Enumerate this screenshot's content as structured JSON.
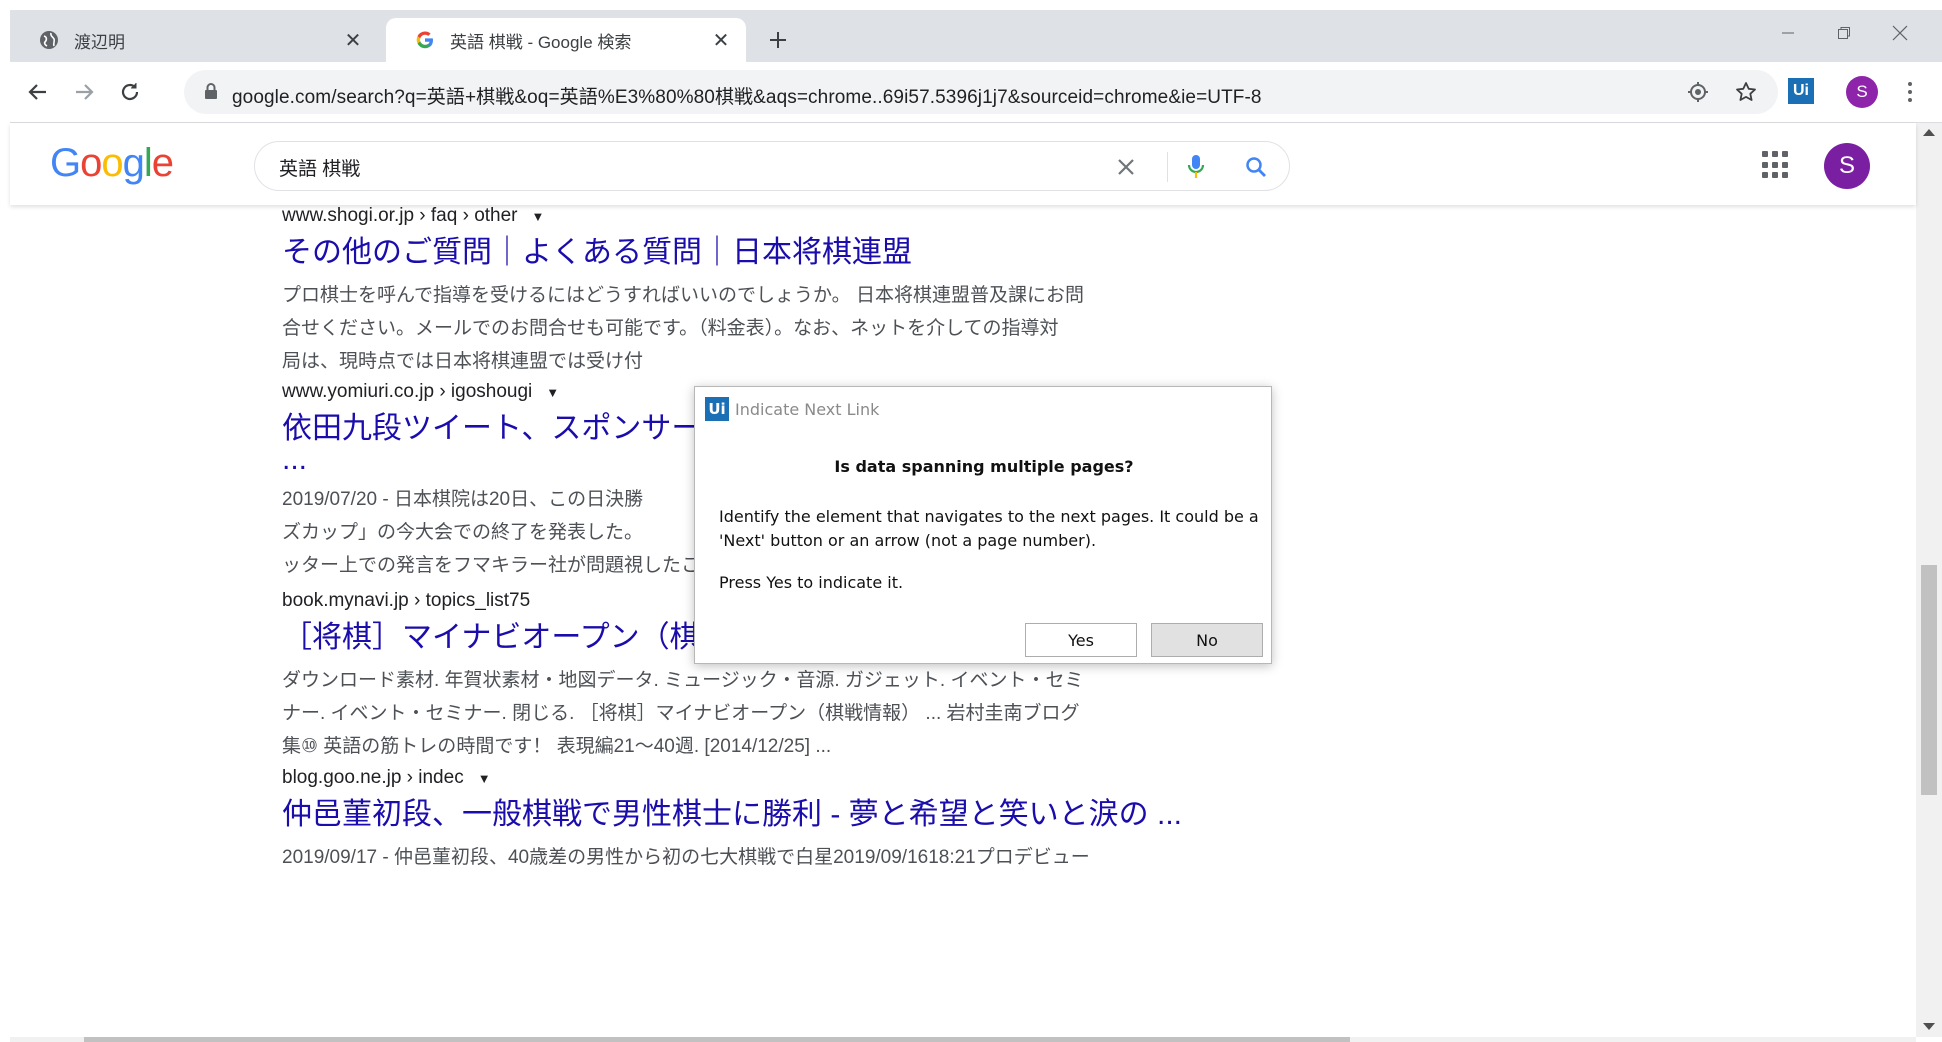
{
  "tabs": [
    {
      "title": "渡辺明",
      "favicon": "globe-icon",
      "active": false
    },
    {
      "title": "英語 棋戦 - Google 検索",
      "favicon": "google-g-icon",
      "active": true
    }
  ],
  "address_bar": {
    "url": "google.com/search?q=英語+棋戦&oq=英語%E3%80%80棋戦&aqs=chrome..69i57.5396j1j7&sourceid=chrome&ie=UTF-8"
  },
  "toolbar": {
    "extension_label": "Ui",
    "profile_initial": "S"
  },
  "google": {
    "logo_letters": [
      "G",
      "o",
      "o",
      "g",
      "l",
      "e"
    ],
    "logo_colors": [
      "#4285f4",
      "#ea4335",
      "#fbbc05",
      "#4285f4",
      "#34a853",
      "#ea4335"
    ],
    "query": "英語 棋戦",
    "profile_initial": "S"
  },
  "results": [
    {
      "cite": "www.shogi.or.jp › faq › other",
      "title": "その他のご質問｜よくある質問｜日本将棋連盟",
      "snippet_lines": [
        "プロ棋士を呼んで指導を受けるにはどうすればいいのでしょうか。 日本将棋連盟普及課にお問",
        "合せください。メールでのお問合せも可能です。（料金表）。なお、ネットを介しての指導対",
        "局は、現時点では日本将棋連盟では受け付"
      ]
    },
    {
      "cite": "www.yomiuri.co.jp › igoshougi",
      "title": "依田九段ツイート、スポンサー",
      "title_cont": "...",
      "snippet_lines": [
        "2019/07/20 - 日本棋院は20日、この日決勝",
        "ズカップ」の今大会での終了を発表した。",
        "ッター上での発言をフマキラー社が問題視したことがきっかけで."
      ]
    },
    {
      "cite": "book.mynavi.jp › topics_list75",
      "title": "［将棋］マイナビオープン（棋戦情報） | マイナビブックス",
      "snippet_lines": [
        "ダウンロード素材. 年賀状素材・地図データ. ミュージック・音源. ガジェット. イベント・セミ",
        "ナー. イベント・セミナー. 閉じる. ［将棋］マイナビオープン（棋戦情報） ... 岩村圭南ブログ",
        "集⑩ 英語の筋トレの時間です！ 表現編21～40週. [2014/12/25] ..."
      ]
    },
    {
      "cite": "blog.goo.ne.jp › indec",
      "title": "仲邑菫初段、一般棋戦で男性棋士に勝利 - 夢と希望と笑いと涙の ...",
      "snippet_lines": [
        "2019/09/17 - 仲邑菫初段、40歳差の男性から初の七大棋戦で白星2019/09/1618:21プロデビュー"
      ]
    }
  ],
  "dialog": {
    "app_logo": "Ui",
    "title": "Indicate Next Link",
    "heading": "Is data spanning multiple pages?",
    "body": "Identify the element that navigates to the next pages. It could be a 'Next' button or an arrow (not a page number).",
    "press_text": "Press Yes to indicate it.",
    "yes_label": "Yes",
    "no_label": "No"
  }
}
